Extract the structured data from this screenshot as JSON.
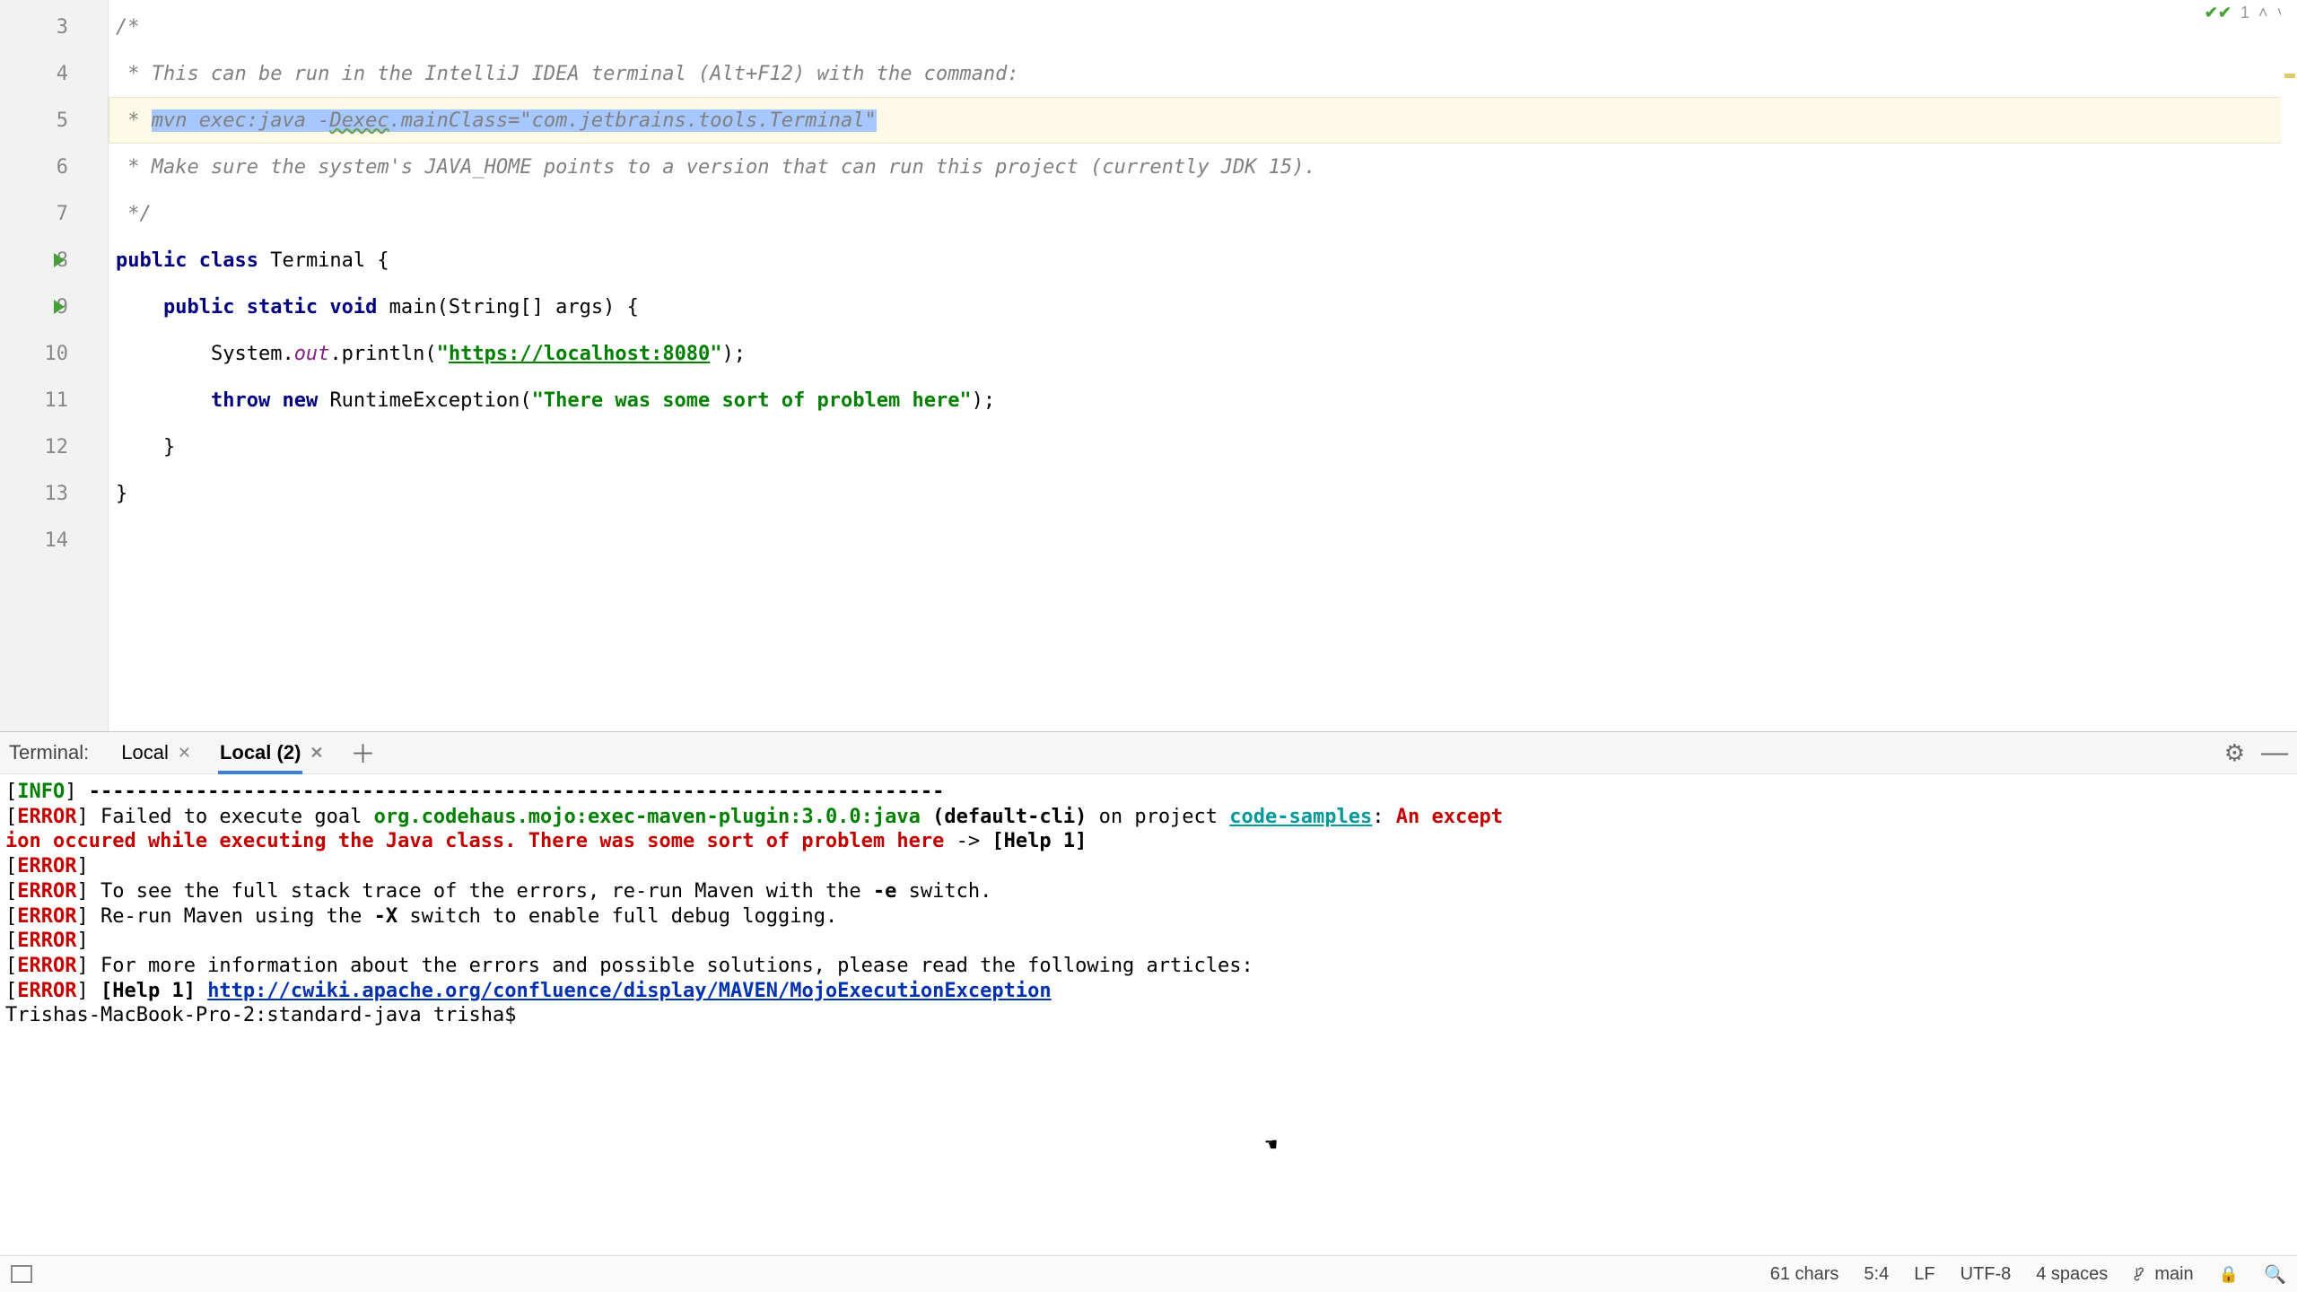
{
  "editor": {
    "lines": {
      "n3": "3",
      "n4": "4",
      "n5": "5",
      "n6": "6",
      "n7": "7",
      "n8": "8",
      "n9": "9",
      "n10": "10",
      "n11": "11",
      "n12": "12",
      "n13": "13",
      "n14": "14"
    },
    "l3": "/*",
    "l4_prefix": " * ",
    "l4_text": "This can be run in the IntelliJ IDEA terminal (Alt+F12) with the command:",
    "l5_prefix": " * ",
    "l5_sel_a": "mvn exec:java -",
    "l5_sel_wavy": "Dexec",
    "l5_sel_b": ".mainClass=\"com.jetbrains.tools.Terminal\"",
    "l6_prefix": " * ",
    "l6_text": "Make sure the system's JAVA_HOME points to a version that can run this project (currently JDK 15).",
    "l7": " */",
    "l8_kw1": "public ",
    "l8_kw2": "class ",
    "l8_name": "Terminal ",
    "l8_brace": "{",
    "l9_indent": "    ",
    "l9_kw1": "public ",
    "l9_kw2": "static ",
    "l9_kw3": "void ",
    "l9_fn": "main",
    "l9_sig": "(String[] args) {",
    "l10_indent": "        ",
    "l10_a": "System.",
    "l10_out": "out",
    "l10_b": ".println(",
    "l10_q1": "\"",
    "l10_url": "https://localhost:8080",
    "l10_q2": "\"",
    "l10_c": ");",
    "l11_indent": "        ",
    "l11_kw1": "throw ",
    "l11_kw2": "new ",
    "l11_cls": "RuntimeException(",
    "l11_str": "\"There was some sort of problem here\"",
    "l11_c": ");",
    "l12": "    }",
    "l13": "}",
    "l14": ""
  },
  "inspection": {
    "count": "1"
  },
  "terminal": {
    "title": "Terminal:",
    "tabs": {
      "t1": "Local",
      "t2": "Local (2)"
    },
    "brackets": {
      "open": "[",
      "close": "]"
    },
    "tags": {
      "info": "INFO",
      "error": "ERROR"
    },
    "dash": " ------------------------------------------------------------------------",
    "fail_a": " Failed to execute goal ",
    "plugin": "org.codehaus.mojo:exec-maven-plugin:3.0.0:java",
    "fail_b": " (default-cli)",
    "fail_c": " on project ",
    "project": "code-samples",
    "colon": ": ",
    "exc_a": "An except",
    "exc_b": "ion occured while executing the Java class. There was some sort of problem here",
    "help_arrow": " -> ",
    "help1": "[Help 1]",
    "stack": " To see the full stack trace of the errors, re-run Maven with the ",
    "e_switch": "-e",
    "stack_end": " switch.",
    "rerun_a": " Re-run Maven using the ",
    "x_switch": "-X",
    "rerun_b": " switch to enable full debug logging.",
    "moreinfo": " For more information about the errors and possible solutions, please read the following articles:",
    "help1_b": " [Help 1] ",
    "url": "http://cwiki.apache.org/confluence/display/MAVEN/MojoExecutionException",
    "prompt": "Trishas-MacBook-Pro-2:standard-java trisha$ "
  },
  "status": {
    "chars": "61 chars",
    "pos": "5:4",
    "eol": "LF",
    "enc": "UTF-8",
    "indent": "4 spaces",
    "branch": "main"
  }
}
